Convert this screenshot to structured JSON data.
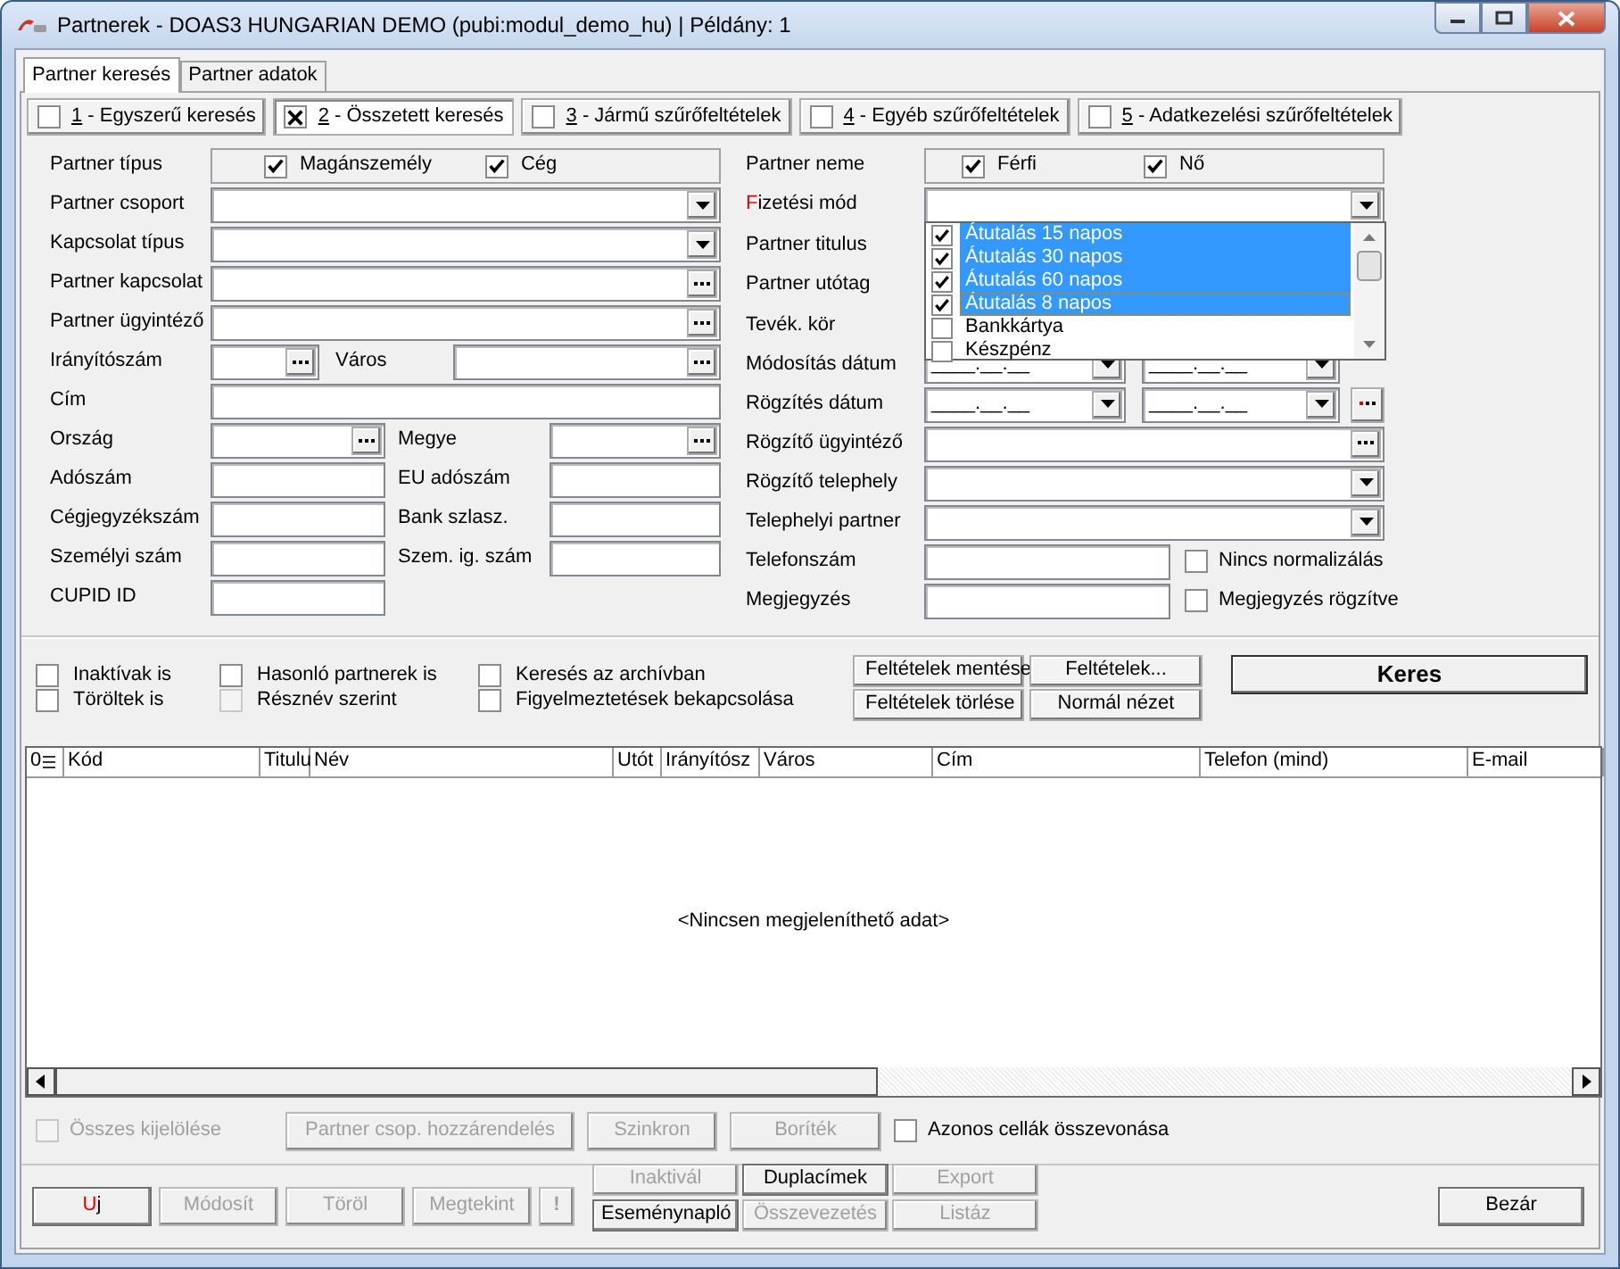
{
  "window": {
    "title": "Partnerek - DOAS3 HUNGARIAN DEMO (pubi:modul_demo_hu) | Példány: 1"
  },
  "tabs": [
    {
      "label": "Partner keresés",
      "selected": true
    },
    {
      "label": "Partner adatok",
      "selected": false
    }
  ],
  "filter_tabs": [
    {
      "label": "1 - Egyszerű keresés",
      "checked": false,
      "selected": false
    },
    {
      "label": "2 - Összetett keresés",
      "checked": true,
      "selected": true
    },
    {
      "label": "3 - Jármű szűrőfeltételek",
      "checked": false,
      "selected": false
    },
    {
      "label": "4 - Egyéb szűrőfeltételek",
      "checked": false,
      "selected": false
    },
    {
      "label": "5 - Adatkezelési szűrőfeltételek",
      "checked": false,
      "selected": false
    }
  ],
  "left_rows": [
    {
      "kind": "checks",
      "label": "Partner típus",
      "options": [
        {
          "label": "Magánszemély",
          "checked": true
        },
        {
          "label": "Cég",
          "checked": true
        }
      ]
    },
    {
      "kind": "combo",
      "label": "Partner csoport"
    },
    {
      "kind": "combo",
      "label": "Kapcsolat típus"
    },
    {
      "kind": "lookup",
      "label": "Partner kapcsolat"
    },
    {
      "kind": "lookup",
      "label": "Partner ügyintéző"
    },
    {
      "kind": "pair_short",
      "fields": [
        {
          "kind": "lookup",
          "label": "Irányítószám"
        },
        {
          "kind": "lookup",
          "label": "Város"
        }
      ]
    },
    {
      "kind": "text",
      "label": "Cím"
    },
    {
      "kind": "pair",
      "fields": [
        {
          "kind": "lookup",
          "label": "Ország"
        },
        {
          "kind": "lookup",
          "label": "Megye"
        }
      ]
    },
    {
      "kind": "pair",
      "fields": [
        {
          "kind": "text",
          "label": "Adószám"
        },
        {
          "kind": "text",
          "label": "EU adószám"
        }
      ]
    },
    {
      "kind": "pair",
      "fields": [
        {
          "kind": "text",
          "label": "Cégjegyzékszám"
        },
        {
          "kind": "text",
          "label": "Bank szlasz."
        }
      ]
    },
    {
      "kind": "pair",
      "fields": [
        {
          "kind": "text",
          "label": "Személyi szám"
        },
        {
          "kind": "text",
          "label": "Szem. ig. szám"
        }
      ]
    },
    {
      "kind": "short",
      "label": "CUPID ID"
    }
  ],
  "right_rows": [
    {
      "kind": "checks",
      "label": "Partner neme",
      "options": [
        {
          "label": "Férfi",
          "checked": true
        },
        {
          "label": "Nő",
          "checked": true
        }
      ]
    },
    {
      "kind": "combo",
      "label": "Fizetési mód",
      "required": true
    },
    {
      "kind": "label",
      "label": "Partner titulus"
    },
    {
      "kind": "label",
      "label": "Partner utótag"
    },
    {
      "kind": "label",
      "label": "Tevék. kör"
    },
    {
      "kind": "daterange",
      "label": "Módosítás dátum",
      "from": "____.__.__",
      "to": "____.__.__",
      "clear_button": false
    },
    {
      "kind": "daterange",
      "label": "Rögzítés dátum",
      "from": "____.__.__",
      "to": "____.__.__",
      "clear_button": true
    },
    {
      "kind": "lookup",
      "label": "Rögzítő ügyintéző"
    },
    {
      "kind": "combo",
      "label": "Rögzítő telephely"
    },
    {
      "kind": "combo",
      "label": "Telephelyi partner"
    },
    {
      "kind": "text_check",
      "label": "Telefonszám",
      "check": {
        "label": "Nincs normalizálás",
        "checked": false
      }
    },
    {
      "kind": "text_check",
      "label": "Megjegyzés",
      "check": {
        "label": "Megjegyzés rögzítve",
        "checked": false
      }
    }
  ],
  "payment_dropdown": {
    "items": [
      {
        "label": "Átutalás 15 napos",
        "checked": true,
        "selected": true,
        "focused": false
      },
      {
        "label": "Átutalás 30 napos",
        "checked": true,
        "selected": true,
        "focused": false
      },
      {
        "label": "Átutalás 60 napos",
        "checked": true,
        "selected": true,
        "focused": false
      },
      {
        "label": "Átutalás 8 napos",
        "checked": true,
        "selected": true,
        "focused": true
      },
      {
        "label": "Bankkártya",
        "checked": false,
        "selected": false,
        "focused": false
      },
      {
        "label": "Készpénz",
        "checked": false,
        "selected": false,
        "focused": false
      }
    ]
  },
  "option_columns": [
    [
      {
        "label": "Inaktívak is",
        "checked": false,
        "disabled": false
      },
      {
        "label": "Töröltek is",
        "checked": false,
        "disabled": false
      }
    ],
    [
      {
        "label": "Hasonló partnerek is",
        "checked": false,
        "disabled": false
      },
      {
        "label": "Résznév szerint",
        "checked": false,
        "disabled": true
      }
    ],
    [
      {
        "label": "Keresés az archívban",
        "checked": false,
        "disabled": false
      },
      {
        "label": "Figyelmeztetések bekapcsolása",
        "checked": false,
        "disabled": false
      }
    ]
  ],
  "filter_buttons": [
    "Feltételek mentése",
    "Feltételek...",
    "Feltételek törlése",
    "Normál nézet"
  ],
  "search_button": "Keres",
  "table": {
    "corner": "0",
    "columns": [
      "Kód",
      "Titulu",
      "Név",
      "Utót",
      "Irányítósz",
      "Város",
      "Cím",
      "Telefon (mind)",
      "E-mail"
    ],
    "empty_message": "<Nincsen megjeleníthető adat>"
  },
  "select_all": {
    "label": "Összes kijelölése",
    "checked": false,
    "disabled": true
  },
  "action_buttons": [
    {
      "label": "Partner csop. hozzárendelés",
      "disabled": true
    },
    {
      "label": "Szinkron",
      "disabled": true
    },
    {
      "label": "Boríték",
      "disabled": true
    }
  ],
  "merge_cells": {
    "label": "Azonos cellák összevonása",
    "checked": false
  },
  "bottom_buttons": [
    {
      "label": "Uj",
      "disabled": false,
      "accent": true
    },
    {
      "label": "Módosít",
      "disabled": true,
      "accent": false
    },
    {
      "label": "Töröl",
      "disabled": true,
      "accent": false
    },
    {
      "label": "Megtekint",
      "disabled": true,
      "accent": false
    },
    {
      "label": "!",
      "disabled": true,
      "accent": false
    }
  ],
  "grid_buttons": [
    {
      "label": "Inaktivál",
      "disabled": true
    },
    {
      "label": "Duplacímek",
      "disabled": false
    },
    {
      "label": "Export",
      "disabled": true
    },
    {
      "label": "Eseménynapló",
      "disabled": false
    },
    {
      "label": "Összevezetés",
      "disabled": true
    },
    {
      "label": "Listáz",
      "disabled": true
    }
  ],
  "close_button": "Bezár"
}
